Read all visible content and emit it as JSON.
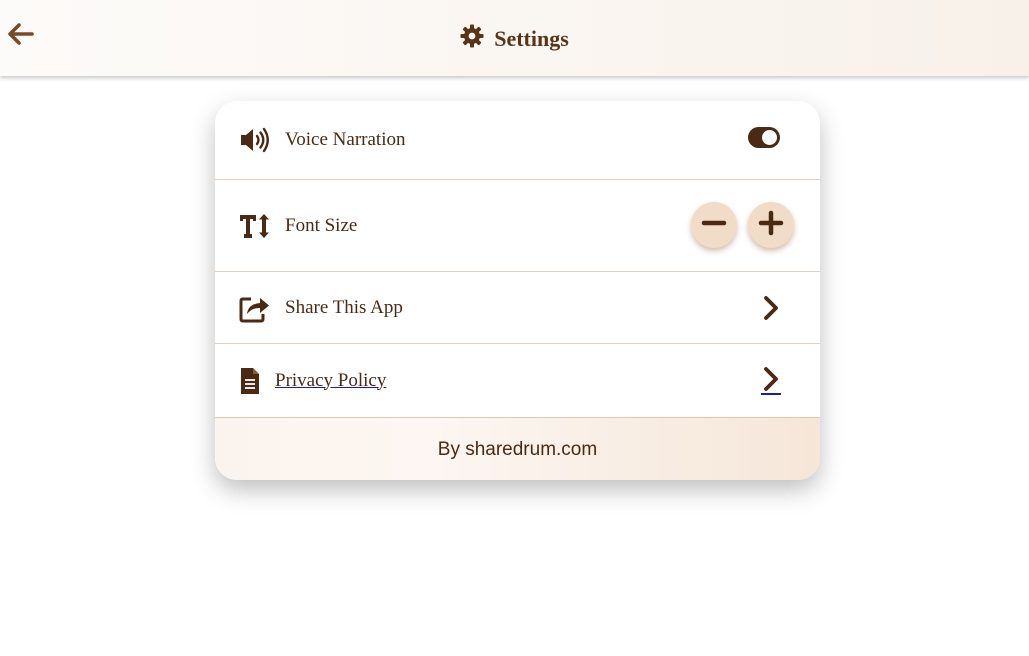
{
  "header": {
    "title": "Settings",
    "back_icon": "arrow-left-icon",
    "title_icon": "gear-icon"
  },
  "settings": {
    "voice_narration": {
      "label": "Voice Narration",
      "icon": "speaker-icon",
      "enabled": true
    },
    "font_size": {
      "label": "Font Size",
      "icon": "text-height-icon",
      "decrease_icon": "minus-icon",
      "increase_icon": "plus-icon"
    },
    "share": {
      "label": "Share This App",
      "icon": "share-icon",
      "chevron_icon": "chevron-right-icon"
    },
    "privacy": {
      "label": "Privacy Policy",
      "icon": "document-icon",
      "chevron_icon": "chevron-right-icon"
    }
  },
  "footer": {
    "text": "By sharedrum.com"
  },
  "colors": {
    "primary": "#4a2a14",
    "accent_light": "#f0dcc7",
    "link_underline": "#1a1ab0",
    "divider": "#e2d2c0"
  }
}
